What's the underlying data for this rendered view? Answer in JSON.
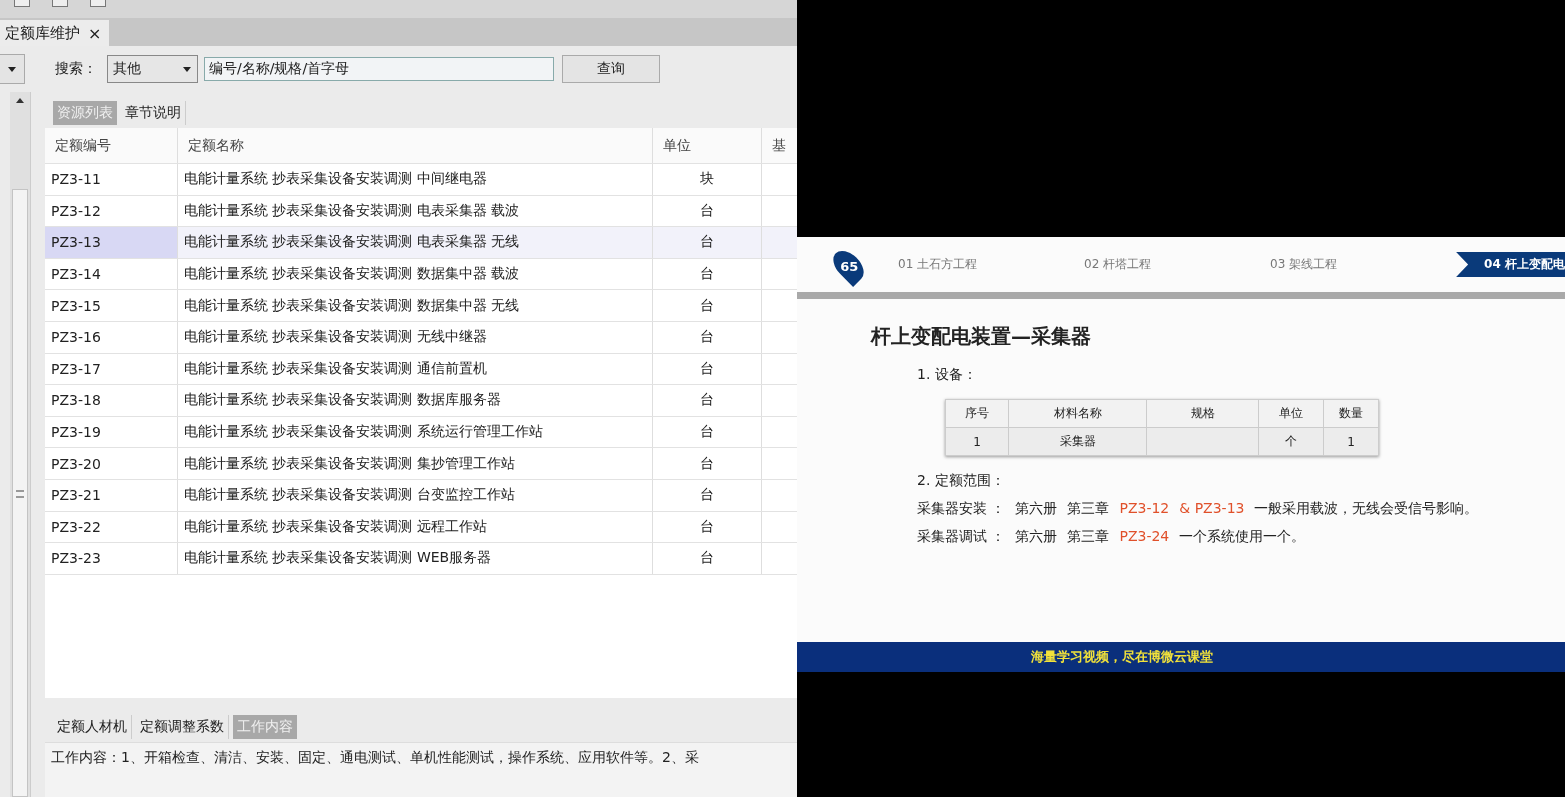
{
  "document_tab": {
    "label": "定额库维护",
    "close": "×"
  },
  "search": {
    "label": "搜索：",
    "category": "其他",
    "value": "编号/名称/规格/首字母",
    "button": "查询"
  },
  "resource_tabs": [
    {
      "label": "资源列表",
      "selected": true
    },
    {
      "label": "章节说明",
      "selected": false
    }
  ],
  "table": {
    "columns": [
      "定额编号",
      "定额名称",
      "单位",
      "基"
    ],
    "rows": [
      {
        "code": "PZ3-11",
        "name": "电能计量系统 抄表采集设备安装调测 中间继电器",
        "unit": "块",
        "selected": false
      },
      {
        "code": "PZ3-12",
        "name": "电能计量系统 抄表采集设备安装调测 电表采集器 载波",
        "unit": "台",
        "selected": false
      },
      {
        "code": "PZ3-13",
        "name": "电能计量系统 抄表采集设备安装调测 电表采集器 无线",
        "unit": "台",
        "selected": true
      },
      {
        "code": "PZ3-14",
        "name": "电能计量系统 抄表采集设备安装调测 数据集中器 载波",
        "unit": "台",
        "selected": false
      },
      {
        "code": "PZ3-15",
        "name": "电能计量系统 抄表采集设备安装调测 数据集中器 无线",
        "unit": "台",
        "selected": false
      },
      {
        "code": "PZ3-16",
        "name": "电能计量系统 抄表采集设备安装调测 无线中继器",
        "unit": "台",
        "selected": false
      },
      {
        "code": "PZ3-17",
        "name": "电能计量系统 抄表采集设备安装调测 通信前置机",
        "unit": "台",
        "selected": false
      },
      {
        "code": "PZ3-18",
        "name": "电能计量系统 抄表采集设备安装调测 数据库服务器",
        "unit": "台",
        "selected": false
      },
      {
        "code": "PZ3-19",
        "name": "电能计量系统 抄表采集设备安装调测 系统运行管理工作站",
        "unit": "台",
        "selected": false
      },
      {
        "code": "PZ3-20",
        "name": "电能计量系统 抄表采集设备安装调测 集抄管理工作站",
        "unit": "台",
        "selected": false
      },
      {
        "code": "PZ3-21",
        "name": "电能计量系统 抄表采集设备安装调测 台变监控工作站",
        "unit": "台",
        "selected": false
      },
      {
        "code": "PZ3-22",
        "name": "电能计量系统 抄表采集设备安装调测 远程工作站",
        "unit": "台",
        "selected": false
      },
      {
        "code": "PZ3-23",
        "name": "电能计量系统 抄表采集设备安装调测 WEB服务器",
        "unit": "台",
        "selected": false
      }
    ]
  },
  "detail_tabs": [
    {
      "label": "定额人材机",
      "selected": false
    },
    {
      "label": "定额调整系数",
      "selected": false
    },
    {
      "label": "工作内容",
      "selected": true
    }
  ],
  "detail_text": "工作内容：1、开箱检查、清洁、安装、固定、通电测试、单机性能测试，操作系统、应用软件等。2、采",
  "slide": {
    "page_badge": "65",
    "steps": [
      {
        "label": "01 土石方工程",
        "selected": false
      },
      {
        "label": "02 杆塔工程",
        "selected": false
      },
      {
        "label": "03 架线工程",
        "selected": false
      },
      {
        "label": "04 杆上变配电",
        "selected": true
      }
    ],
    "title": "杆上变配电装置—采集器",
    "section_1": "1. 设备：",
    "equipment_table": {
      "columns": [
        "序号",
        "材料名称",
        "规格",
        "单位",
        "数量"
      ],
      "rows": [
        [
          "1",
          "采集器",
          null,
          "个",
          "1"
        ]
      ]
    },
    "section_2": "2. 定额范围：",
    "scope_lines": [
      {
        "segments": [
          {
            "kind": "text",
            "text": "采集器安装 ："
          },
          {
            "kind": "text",
            "text": "第六册"
          },
          {
            "kind": "text",
            "text": "第三章"
          },
          {
            "kind": "code",
            "text": "PZ3-12"
          },
          {
            "kind": "code",
            "text": "& PZ3-13"
          },
          {
            "kind": "text",
            "text": "一般采用载波，无线会受信号影响。"
          }
        ]
      },
      {
        "segments": [
          {
            "kind": "text",
            "text": "采集器调试 ："
          },
          {
            "kind": "text",
            "text": "第六册"
          },
          {
            "kind": "text",
            "text": "第三章"
          },
          {
            "kind": "code",
            "text": "PZ3-24"
          },
          {
            "kind": "text",
            "text": "一个系统使用一个。"
          }
        ]
      }
    ],
    "footer": "海量学习视频，尽在博微云课堂"
  }
}
